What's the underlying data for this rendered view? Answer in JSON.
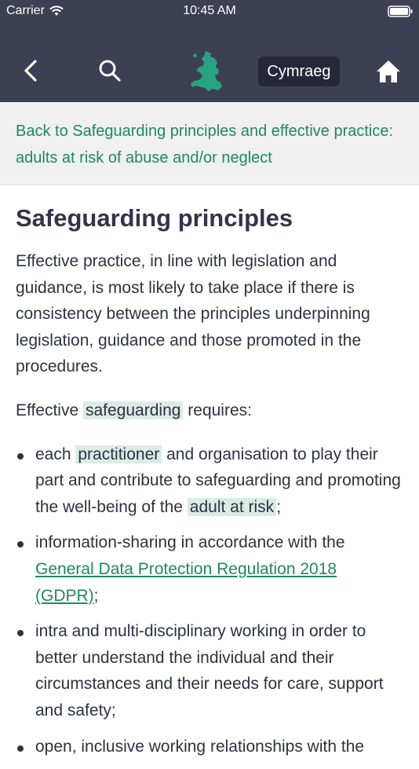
{
  "status_bar": {
    "carrier": "Carrier",
    "time": "10:45 AM"
  },
  "nav": {
    "language_label": "Cymraeg",
    "icons": {
      "back": "chevron-left-icon",
      "search": "search-icon",
      "logo": "wales-map-logo",
      "home": "home-icon"
    }
  },
  "back_link": {
    "text": "Back to Safeguarding principles and effective practice: adults at risk of abuse and/or neglect"
  },
  "article": {
    "title": "Safeguarding principles",
    "intro": "Effective practice, in line with legislation and guidance, is most likely to take place if there is consistency between the principles underpinning legislation, guidance and those promoted in the procedures.",
    "lead_before": "Effective ",
    "lead_highlight": "safeguarding",
    "lead_after": " requires:",
    "bullets": [
      {
        "before": "each ",
        "highlight": "practitioner",
        "middle": " and organisation to play their part and contribute to safeguarding and promoting the well-being of the ",
        "highlight2": "adult at risk",
        "after": ";"
      },
      {
        "before": "information-sharing in accordance with the ",
        "link": "General Data Protection Regulation 2018 (GDPR)",
        "after": ";"
      },
      {
        "text": "intra and multi-disciplinary working in order to better understand the individual and their circumstances and their needs for care, support and safety;"
      },
      {
        "text": "open, inclusive working relationships with the"
      }
    ]
  },
  "colors": {
    "nav_background": "#3d3f52",
    "accent_green": "#1e8866",
    "highlight_background": "#dcebe6",
    "body_text": "#2f3142",
    "back_bar_background": "#f0f0f0"
  }
}
